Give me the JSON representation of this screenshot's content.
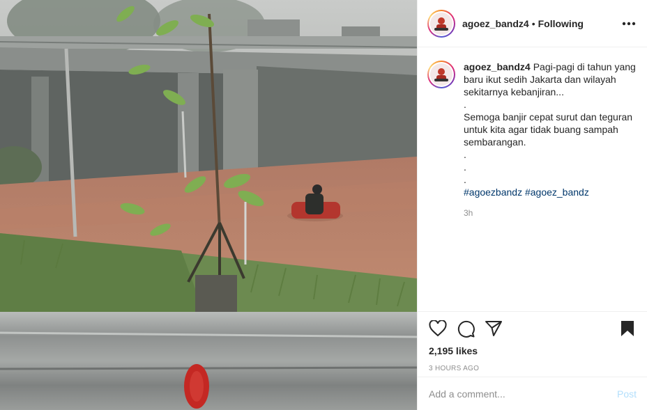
{
  "post": {
    "username": "agoez_bandz4",
    "separator": "•",
    "follow_status": "Following",
    "more_icon": "more-horizontal-icon"
  },
  "caption": {
    "username": "agoez_bandz4",
    "lines": [
      "Pagi-pagi di tahun yang baru ikut sedih Jakarta dan wilayah sekitarnya kebanjiran...",
      ".",
      "Semoga banjir cepat surut dan teguran untuk kita agar tidak buang sampah sembarangan.",
      ".",
      ".",
      "."
    ],
    "hashtags": "#agoezbandz #agoez_bandz",
    "age": "3h"
  },
  "actions": {
    "icons": [
      "heart-icon",
      "comment-icon",
      "share-icon",
      "bookmark-icon"
    ],
    "likes": "2,195 likes",
    "timestamp": "3 HOURS AGO"
  },
  "comment": {
    "placeholder": "Add a comment...",
    "post_label": "Post"
  },
  "colors": {
    "link": "#00376b",
    "muted": "#8e8e8e",
    "post_disabled": "#b2dffc",
    "flood_water": "#b5785f"
  }
}
